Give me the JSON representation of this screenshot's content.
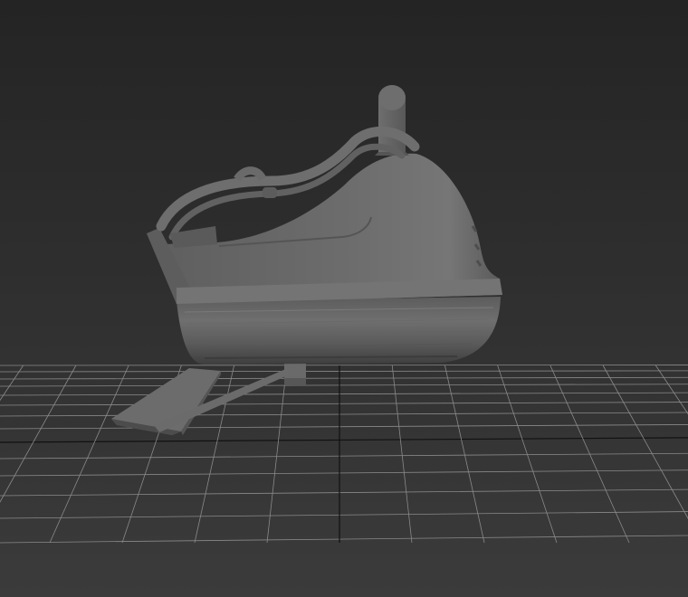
{
  "viewport": {
    "shading": "shaded-gray",
    "background_top_color": "#242424",
    "background_bottom_color": "#3b3b3b",
    "grid_visible": true,
    "grid_color": "#8a8a8a",
    "grid_axis_color": "#111111",
    "model_color": "#6a6a6a"
  },
  "model": {
    "name_icon": "iron-3d-model",
    "parts": [
      "hull",
      "top-shell",
      "handle",
      "knob",
      "cord",
      "cord-stand",
      "base-plate"
    ]
  }
}
